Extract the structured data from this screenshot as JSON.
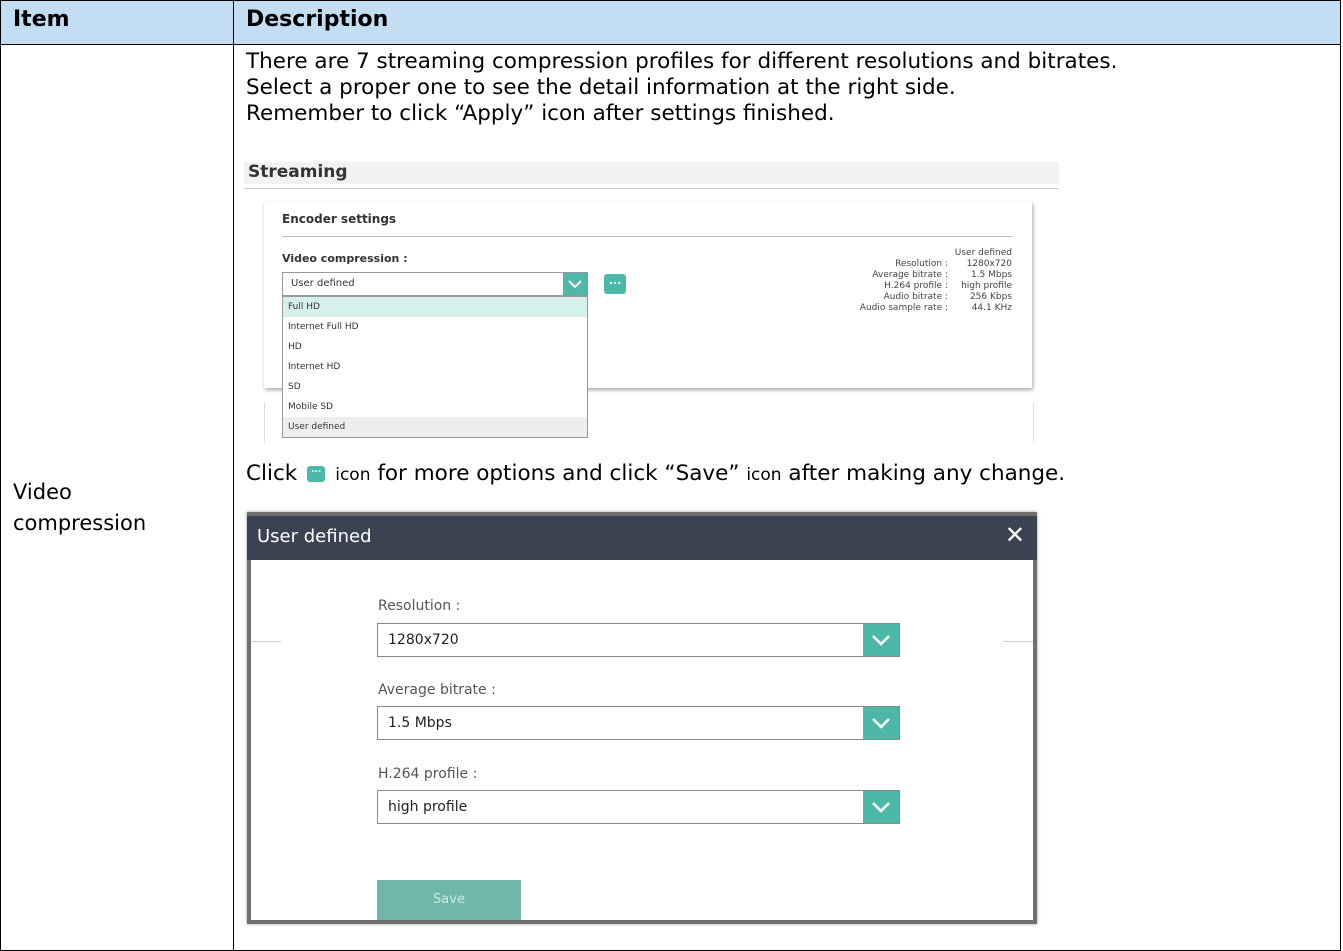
{
  "table": {
    "header_item": "Item",
    "header_desc": "Description",
    "item_label": "Video compression"
  },
  "intro": {
    "line1": "There are 7 streaming compression profiles for different resolutions and bitrates.",
    "line2": "Select a proper one to see the detail information at the right side.",
    "line3": "Remember to click “Apply” icon after settings finished."
  },
  "streaming": {
    "title": "Streaming",
    "panel_title": "Encoder settings",
    "video_compression_label": "Video compression :",
    "selected_value": "User defined",
    "more_button_glyph": "...",
    "options": [
      "Full HD",
      "Internet Full HD",
      "HD",
      "Internet HD",
      "SD",
      "Mobile SD",
      "User defined"
    ],
    "details_title": "User defined",
    "details": [
      {
        "key": "Resolution :",
        "value": "1280x720"
      },
      {
        "key": "Average bitrate :",
        "value": "1.5 Mbps"
      },
      {
        "key": "H.264 profile :",
        "value": "high profile"
      },
      {
        "key": "Audio bitrate :",
        "value": "256 Kbps"
      },
      {
        "key": "Audio sample rate :",
        "value": "44.1 KHz"
      }
    ]
  },
  "click_line": {
    "before": "Click",
    "icon_word": "icon",
    "middle": "for more options and click “Save”",
    "icon_word2": "icon",
    "after": "after making any change."
  },
  "modal": {
    "title": "User defined",
    "close_glyph": "✕",
    "resolution_label": "Resolution :",
    "resolution_value": "1280x720",
    "bitrate_label": "Average bitrate :",
    "bitrate_value": "1.5 Mbps",
    "profile_label": "H.264 profile :",
    "profile_value": "high profile",
    "save_label": "Save"
  },
  "colors": {
    "header_bg": "#c3ddf2",
    "accent": "#4cb8a8",
    "modal_header": "#3b4353"
  },
  "icons": [
    "chevron-down-icon",
    "more-options-icon",
    "close-icon"
  ]
}
